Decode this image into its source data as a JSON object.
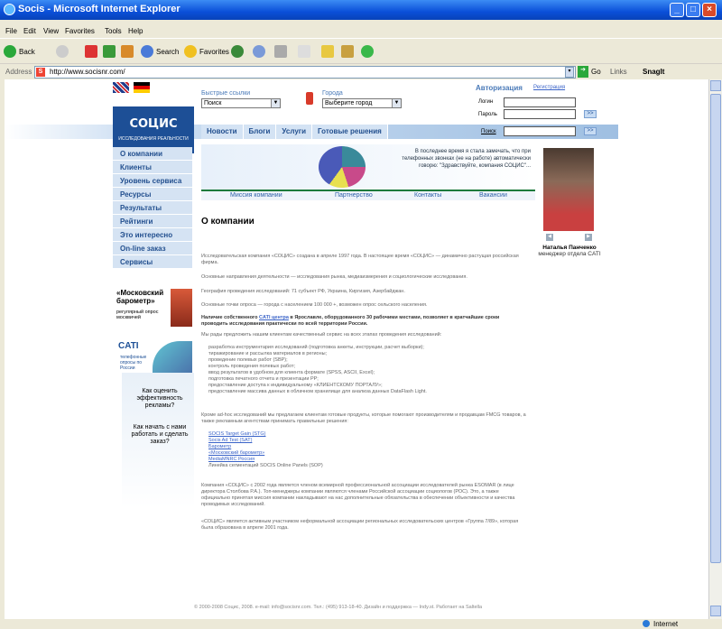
{
  "window": {
    "title": "Socis - Microsoft Internet Explorer"
  },
  "menu": [
    "File",
    "Edit",
    "View",
    "Favorites",
    "Tools",
    "Help"
  ],
  "toolbar": {
    "back": "Back",
    "search": "Search",
    "favorites": "Favorites",
    "go": "Go",
    "links": "Links",
    "snagit": "SnagIt"
  },
  "address": {
    "label": "Address",
    "url": "http://www.socisnr.com/"
  },
  "status": {
    "zone": "Internet"
  },
  "page": {
    "logo": "СОЦИС",
    "logo_sub": "ИССЛЕДОВАНИЯ РЕАЛЬНОСТИ",
    "quick_links_label": "Быстрые ссылки",
    "quick_links_value": "Поиск",
    "city_label": "Города",
    "city_value": "Выберите город",
    "auth_title": "Авторизация",
    "register": "Регистрация",
    "login_label": "Логин",
    "password_label": "Пароль",
    "search_label": "Поиск",
    "nav": [
      "Новости",
      "Блоги",
      "Услуги",
      "Готовые решения"
    ],
    "banner_text": "В последнее время я стала замечать, что при телефонных звонках (не на работе) автоматически говорю: \"Здравствуйте, компания СОЦИС\"...",
    "subnav": [
      "Миссия компании",
      "Партнерство",
      "Контакты",
      "Вакансии"
    ],
    "left_menu": [
      "О компании",
      "Клиенты",
      "Уровень сервиса",
      "Ресурсы",
      "Результаты",
      "Рейтинги",
      "Это интересно",
      "On-line заказ",
      "Сервисы"
    ],
    "promo_barometer_title": "«Московский барометр»",
    "promo_barometer_sub": "регулярный опрос москвичей",
    "promo_cati": "CATI",
    "promo_cati_sub": "телефонные опросы по России",
    "promo_q1": "Как оценить эффективность рекламы?",
    "promo_q2": "Как начать с нами работать и сделать заказ?",
    "photo_name": "Наталья Панченко",
    "photo_role": "менеджер отдела CATI",
    "heading": "О компании",
    "p1": "Исследовательская компания «СОЦИС» создана в апреле 1997 года. В настоящее время «СОЦИС» — динамично растущая российская фирма.",
    "p2": "Основные направления деятельности — исследования рынка, медиаизмерения и социологические исследования.",
    "p3": "География проведения исследований: 71 субъект РФ, Украина, Киргизия, Азербайджан.",
    "p4": "Основные точки опроса — города с населением 100 000 +, возможен опрос сельского населения.",
    "p5_pre": "Наличие собственного",
    "p5_link": "CATI центра",
    "p5_post": "в Ярославле, оборудованного 30 рабочими местами, позволяет в кратчайшие сроки проводить исследования практически по всей территории России.",
    "p6": "Мы рады предложить нашим клиентам качественный сервис на всех этапах проведения исследований:",
    "list1": [
      "разработка инструментария исследований (подготовка анкеты, инструкции, расчет выборки);",
      "тиражирование и рассылка материалов в регионы;",
      "проведение полевых работ (SBP);",
      "контроль проведения полевых работ;",
      "ввод результатов в удобном для клиента формате (SPSS, ASCII, Excel);",
      "подготовка печатного отчета и презентации PP;",
      "предоставление доступа к индивидуальному «КЛИЕНТСКОМУ ПОРТАЛУ»;",
      "предоставление массива данных в облачном хранилище для анализа данных DataFlash Light."
    ],
    "p7": "Кроме ad-hoc исследований мы предлагаем клиентам готовые продукты, которые помогают производителям и продавцам FMCG товаров, а также рекламным агентствам принимать правильные решения:",
    "list2": [
      "SOCIS Target Gain (STG)",
      "Socis Ad Test (SAT)",
      "Баромeтр",
      "«Московский барометр»",
      "MediaMNRC Россия",
      "Линейка сегментаций SOCIS Online Panels (SOP)"
    ],
    "p8": "Компания «СОЦИС» с 2002 года является членом всемирной профессиональной ассоциации исследователей рынка ESOMAR (в лице директора Столбова Р.А.). Топ-менеджеры компании являются членами Российской ассоциации социологов (РОС). Это, а также официально принятая миссия компании накладывают на нас дополнительные обязательства в обеспечении объективности и качества проводимых исследований.",
    "p9": "«СОЦИС» является активным участником неформальной ассоциации региональных исследовательских центров «Группа 7/89», которая была образована в апреле 2001 года.",
    "footer": "© 2000-2008 Социс, 2008. e-mail: info@socisnr.com. Тел.: (495) 913-18-40. Дизайн и поддержка — Indy.st. Работает на Saltella"
  }
}
